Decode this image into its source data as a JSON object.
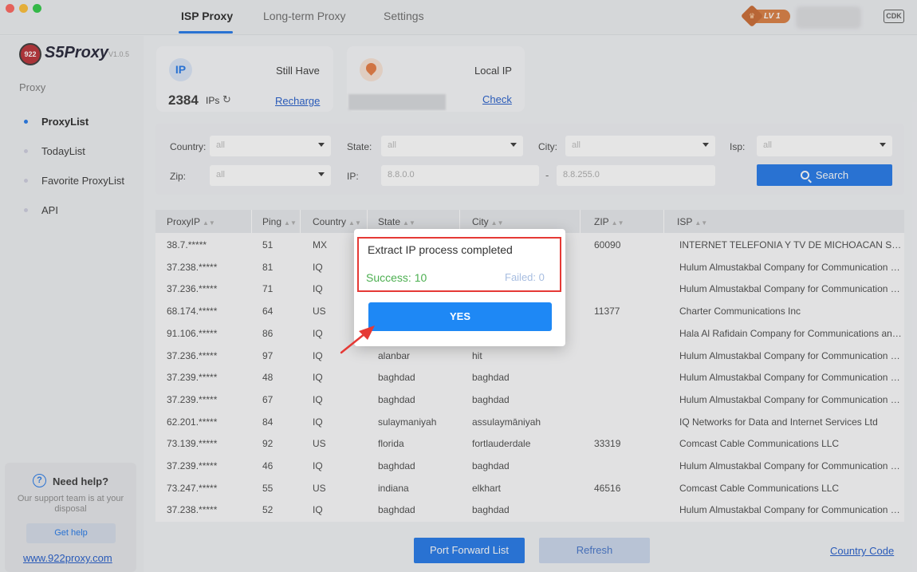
{
  "titlebar": {
    "tabs": [
      "ISP Proxy",
      "Long-term Proxy",
      "Settings"
    ],
    "level": "LV 1",
    "cdk": "CDK"
  },
  "sidebar": {
    "logo_badge": "922",
    "logo_text": "S5Proxy",
    "version": "V1.0.5",
    "heading": "Proxy",
    "items": [
      {
        "label": "ProxyList",
        "active": true
      },
      {
        "label": "TodayList",
        "active": false
      },
      {
        "label": "Favorite ProxyList",
        "active": false
      },
      {
        "label": "API",
        "active": false
      }
    ],
    "help": {
      "title": "Need help?",
      "subtitle": "Our support team is at your disposal",
      "button": "Get help",
      "link": "www.922proxy.com"
    }
  },
  "stats": {
    "ip_icon": "IP",
    "still_have_label": "Still Have",
    "ip_count": "2384",
    "ip_unit": "IPs",
    "recharge": "Recharge",
    "local_ip_label": "Local IP",
    "check": "Check"
  },
  "filters": {
    "country_label": "Country:",
    "country_value": "all",
    "state_label": "State:",
    "state_value": "all",
    "city_label": "City:",
    "city_value": "all",
    "isp_label": "Isp:",
    "isp_value": "all",
    "zip_label": "Zip:",
    "zip_value": "all",
    "ip_label": "IP:",
    "ip_from": "8.8.0.0",
    "ip_to": "8.8.255.0",
    "dash": "-",
    "search": "Search"
  },
  "table": {
    "columns": [
      "ProxyIP",
      "Ping",
      "Country",
      "State",
      "City",
      "ZIP",
      "ISP"
    ],
    "rows": [
      [
        "38.7.*****",
        "51",
        "MX",
        "",
        "",
        "60090",
        "INTERNET TELEFONIA Y TV DE MICHOACAN SA DE ..."
      ],
      [
        "37.238.*****",
        "81",
        "IQ",
        "",
        "",
        "",
        "Hulum Almustakbal Company for Communication En..."
      ],
      [
        "37.236.*****",
        "71",
        "IQ",
        "",
        "",
        "",
        "Hulum Almustakbal Company for Communication En..."
      ],
      [
        "68.174.*****",
        "64",
        "US",
        "",
        "",
        "11377",
        "Charter Communications Inc"
      ],
      [
        "91.106.*****",
        "86",
        "IQ",
        "",
        "",
        "",
        "Hala Al Rafidain Company for Communications and I..."
      ],
      [
        "37.236.*****",
        "97",
        "IQ",
        "alanbar",
        "hit",
        "",
        "Hulum Almustakbal Company for Communication En..."
      ],
      [
        "37.239.*****",
        "48",
        "IQ",
        "baghdad",
        "baghdad",
        "",
        "Hulum Almustakbal Company for Communication En..."
      ],
      [
        "37.239.*****",
        "67",
        "IQ",
        "baghdad",
        "baghdad",
        "",
        "Hulum Almustakbal Company for Communication En..."
      ],
      [
        "62.201.*****",
        "84",
        "IQ",
        "sulaymaniyah",
        "assulaymāniyah",
        "",
        "IQ Networks for Data and Internet Services Ltd"
      ],
      [
        "73.139.*****",
        "92",
        "US",
        "florida",
        "fortlauderdale",
        "33319",
        "Comcast Cable Communications LLC"
      ],
      [
        "37.239.*****",
        "46",
        "IQ",
        "baghdad",
        "baghdad",
        "",
        "Hulum Almustakbal Company for Communication En..."
      ],
      [
        "73.247.*****",
        "55",
        "US",
        "indiana",
        "elkhart",
        "46516",
        "Comcast Cable Communications LLC"
      ],
      [
        "37.238.*****",
        "52",
        "IQ",
        "baghdad",
        "baghdad",
        "",
        "Hulum Almustakbal Company for Communication En..."
      ]
    ]
  },
  "bottom": {
    "port_forward": "Port Forward List",
    "refresh": "Refresh",
    "country_code": "Country Code"
  },
  "modal": {
    "title": "Extract IP process completed",
    "success": "Success: 10",
    "failed": "Failed: 0",
    "yes": "YES"
  },
  "colors": {
    "accent": "#1a73e8",
    "success": "#4caf50",
    "highlight": "#e53935"
  }
}
